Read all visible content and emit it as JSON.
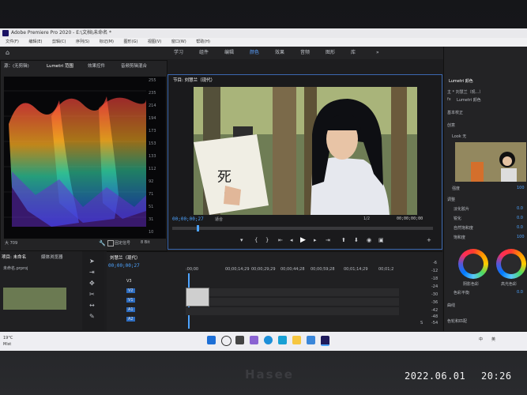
{
  "app": {
    "title": "Adobe Premiere Pro 2020 - E:\\文档\\未命名 *"
  },
  "menu": [
    "文件(F)",
    "编辑(E)",
    "剪辑(C)",
    "序列(S)",
    "标记(M)",
    "图形(G)",
    "视图(V)",
    "窗口(W)",
    "帮助(H)"
  ],
  "workspaces": {
    "items": [
      "学习",
      "组件",
      "编辑",
      "颜色",
      "效果",
      "音频",
      "图形",
      "库"
    ],
    "active": "颜色",
    "more": "»"
  },
  "scope_panel": {
    "tabs": [
      "源：(无剪辑)",
      "Lumetri 范围",
      "效果控件",
      "音频剪辑混合"
    ],
    "scale": [
      "255",
      "235",
      "214",
      "194",
      "173",
      "153",
      "133",
      "112",
      "92",
      "71",
      "51",
      "31",
      "10"
    ],
    "footer_left": "大 709",
    "footer_option": "固定信号",
    "footer_bits": "8 Bit"
  },
  "program_monitor": {
    "title": "节目: 刘慧兰（现代）",
    "timecode_current": "00;00;00;27",
    "fit": "适合",
    "resolution": "1/2",
    "timecode_total": "00;00;00;00"
  },
  "project_panel": {
    "tabs": [
      "项目: 未命名",
      "媒体浏览器"
    ],
    "file": "未命名.prproj"
  },
  "timeline": {
    "tab": "刘慧兰（现代）",
    "timecode": "00;00;00;27",
    "ruler": [
      ":00;00",
      "00;00;14;29",
      "00;00;29;29",
      "00;00;44;28",
      "00;00;59;28",
      "00;01;14;29",
      "00;01;2"
    ],
    "video_tracks": [
      "V3",
      "V2",
      "V1"
    ],
    "audio_tracks": [
      "A1",
      "A2",
      "A3"
    ]
  },
  "meter": {
    "labels": [
      "-6",
      "-12",
      "-18",
      "-24",
      "-30",
      "-36",
      "-42",
      "-48",
      "-54"
    ],
    "s_label": "S"
  },
  "lumetri": {
    "title": "Lumetri 颜色",
    "sub": "主 * 刘慧兰（现...）",
    "fx": "Lumetri 颜色",
    "sections": [
      "基本校正",
      "创意",
      "曲线",
      "色轮和匹配"
    ],
    "look": "Look 无",
    "intensity_label": "强度",
    "intensity_val": "100",
    "fade_label": "淡化胶片",
    "sharpen_label": "锐化",
    "nature_label": "自然饱和度",
    "sat_label": "饱和度",
    "adjust_label": "调整",
    "val1": "0.0",
    "val2": "0.0",
    "val3": "0.0",
    "val4": "100",
    "shadow_label": "阴影色彩",
    "high_label": "高光色彩",
    "balance_label": "色彩平衡",
    "balance_val": "0.0",
    "vignette": "晕影",
    "hsl": "HSL辅助"
  },
  "taskbar": {
    "weather_temp": "19°C",
    "weather_text": "Mist",
    "lang": "中",
    "input": "英"
  },
  "device": {
    "brand": "Hasee"
  },
  "photo_stamp": {
    "date": "2022.06.01",
    "time": "20:26"
  }
}
